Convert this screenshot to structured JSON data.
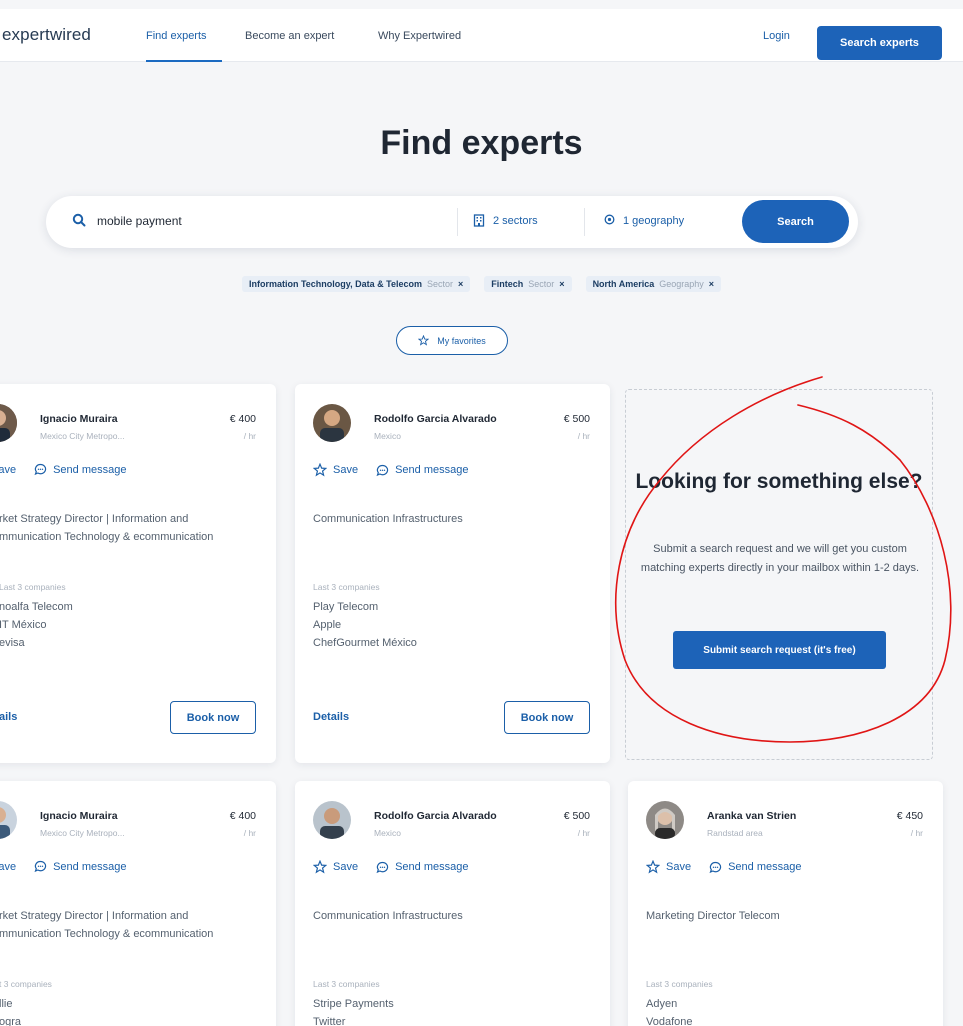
{
  "header": {
    "logo": "expertwired",
    "nav": [
      "Find experts",
      "Become an expert",
      "Why Expertwired"
    ],
    "login": "Login",
    "search_experts": "Search experts"
  },
  "title": "Find experts",
  "search": {
    "query": "mobile payment",
    "sectors": "2 sectors",
    "geography": "1 geography",
    "button": "Search"
  },
  "chips": [
    {
      "label": "Information Technology, Data & Telecom",
      "type": "Sector"
    },
    {
      "label": "Fintech",
      "type": "Sector"
    },
    {
      "label": "North America",
      "type": "Geography"
    }
  ],
  "favorites": "My favorites",
  "actions": {
    "save": "Save",
    "message": "Send message",
    "details": "Details",
    "book": "Book now",
    "last_label": "Last 3 companies"
  },
  "experts": [
    {
      "name": "Ignacio Muraira",
      "location": "Mexico City Metropo...",
      "price": "€ 400",
      "unit": "/ hr",
      "role": "rket Strategy Director | Information and mmunication Technology & ecommunication",
      "companies": [
        "noalfa Telecom",
        "IT México",
        "evisa"
      ]
    },
    {
      "name": "Rodolfo Garcia Alvarado",
      "location": "Mexico",
      "price": "€ 500",
      "unit": "/ hr",
      "role": "Communication Infrastructures",
      "companies": [
        "Play Telecom",
        "Apple",
        "ChefGourmet México"
      ]
    },
    {
      "name": "Ignacio Muraira",
      "location": "Mexico City Metropo...",
      "price": "€ 400",
      "unit": "/ hr",
      "role": "rket Strategy Director | Information and mmunication Technology & ecommunication",
      "last_label": "t 3 companies",
      "companies": [
        "llie",
        "ogra"
      ]
    },
    {
      "name": "Rodolfo Garcia Alvarado",
      "location": "Mexico",
      "price": "€ 500",
      "unit": "/ hr",
      "role": "Communication Infrastructures",
      "companies": [
        "Stripe Payments",
        "Twitter"
      ]
    },
    {
      "name": "Aranka van Strien",
      "location": "Randstad area",
      "price": "€ 450",
      "unit": "/ hr",
      "role": "Marketing Director Telecom",
      "companies": [
        "Adyen",
        "Vodafone"
      ]
    }
  ],
  "promo": {
    "title": "Looking for something else?",
    "text": "Submit a search request and we will get you custom matching experts directly in your mailbox within 1-2 days.",
    "button": "Submit search request (it's free)"
  },
  "colors": {
    "accent": "#1d63b8",
    "annotation": "#e01515"
  }
}
